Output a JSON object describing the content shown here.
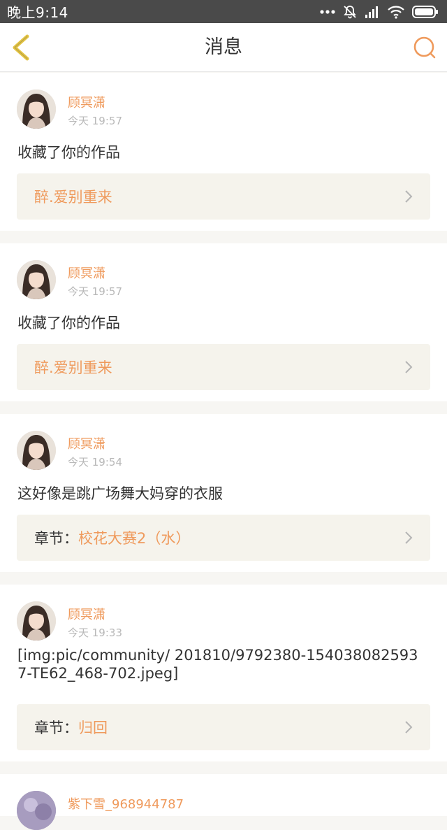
{
  "status_bar": {
    "time": "晚上9:14"
  },
  "header": {
    "title": "消息"
  },
  "colors": {
    "accent": "#ef9a5c",
    "back_icon": "#e3c341",
    "card_ref_bg": "#f5f3ec"
  },
  "messages": [
    {
      "user": "顾冥潇",
      "time": "今天 19:57",
      "text": "收藏了你的作品",
      "ref_prefix": "",
      "ref_title": "醉.爱别重来"
    },
    {
      "user": "顾冥潇",
      "time": "今天 19:57",
      "text": "收藏了你的作品",
      "ref_prefix": "",
      "ref_title": "醉.爱别重来"
    },
    {
      "user": "顾冥潇",
      "time": "今天 19:54",
      "text": "这好像是跳广场舞大妈穿的衣服",
      "ref_prefix": "章节：",
      "ref_title": "校花大赛2（水）"
    },
    {
      "user": "顾冥潇",
      "time": "今天 19:33",
      "text": "[img:pic/community/ 201810/9792380-1540380825937-TE62_468-702.jpeg]",
      "ref_prefix": "章节：",
      "ref_title": "归回"
    },
    {
      "user": "紫下雪_968944787",
      "time": "",
      "text": "",
      "ref_prefix": "",
      "ref_title": ""
    }
  ]
}
